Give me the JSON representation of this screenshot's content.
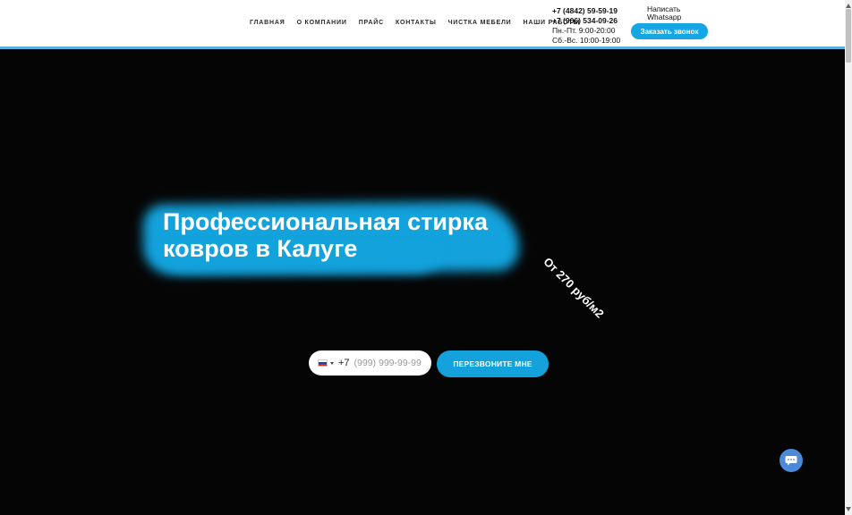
{
  "nav": {
    "items": [
      {
        "label": "ГЛАВНАЯ"
      },
      {
        "label": "О КОМПАНИИ"
      },
      {
        "label": "ПРАЙС"
      },
      {
        "label": "КОНТАКТЫ"
      },
      {
        "label": "ЧИСТКА МЕБЕЛИ"
      },
      {
        "label": "НАШИ РАБОТЫ"
      }
    ]
  },
  "contacts": {
    "phone1": "+7 (4842) 59-59-19",
    "phone2": "+7 (906) 534-09-26",
    "hours_weekdays": "Пн.-Пт. 9:00-20:00",
    "hours_weekend": "Сб.-Вс. 10:00-19:00"
  },
  "header": {
    "whatsapp_label": "Написать Whatsapp",
    "call_button_label": "Заказать звонок"
  },
  "hero": {
    "title": "Профессиональная стирка ковров в Калуге",
    "price": "От 270 руб/м2",
    "phone_prefix": "+7",
    "phone_placeholder": "(999) 999-99-99",
    "cta_label": "ПЕРЕЗВОНИТЕ МНЕ"
  },
  "colors": {
    "accent": "#13a2dc",
    "header_border": "#5aaee0",
    "hero_bg": "#050505",
    "chat_button": "#4a8ad8"
  },
  "icons": {
    "flag": "russia-flag-icon",
    "chevron": "chevron-down-icon",
    "chat": "chat-bubble-icon"
  }
}
